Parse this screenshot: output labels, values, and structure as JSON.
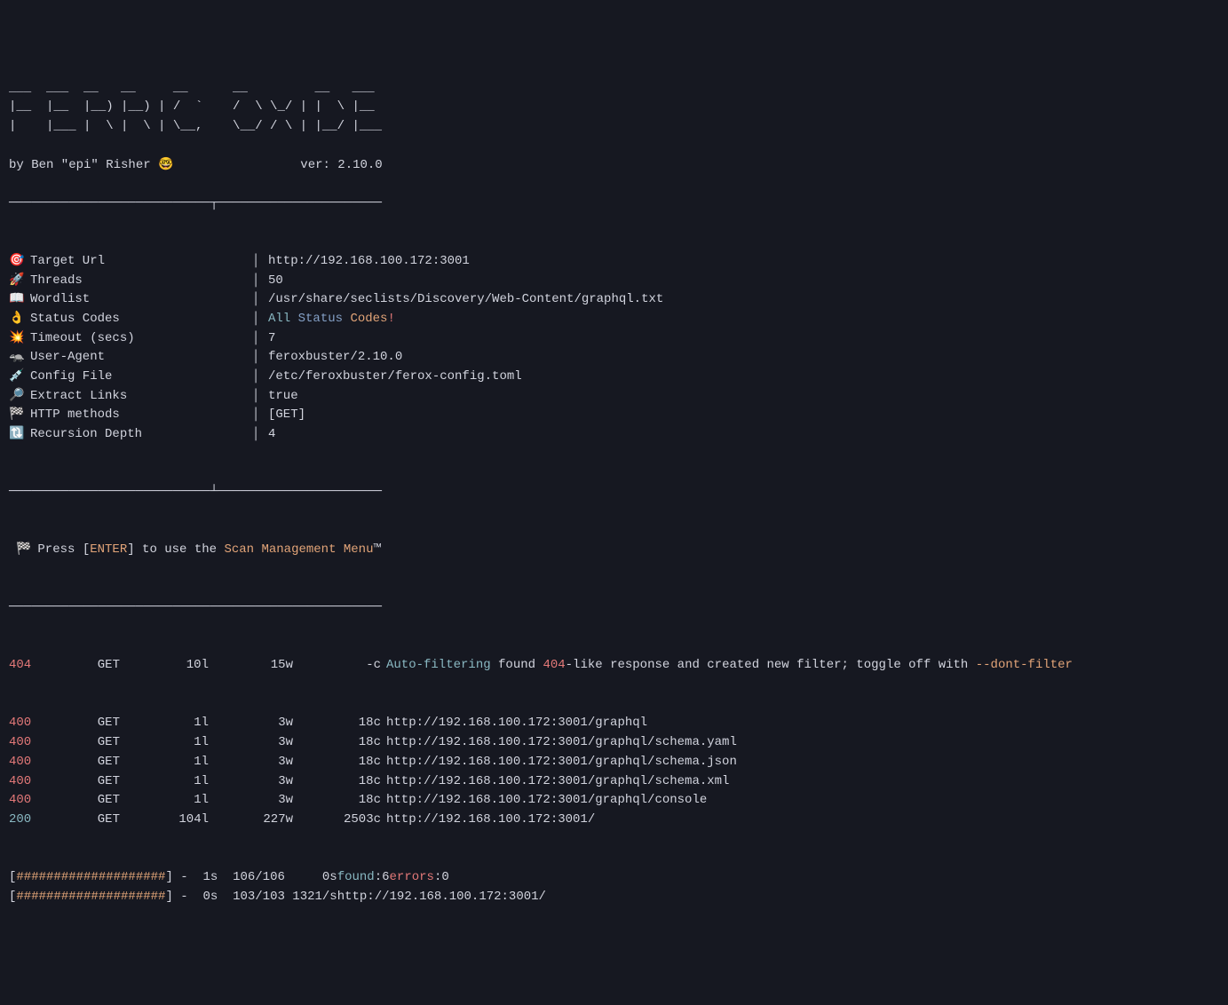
{
  "ascii_art": "___  ___  __   __     __      __         __   ___\n|__  |__  |__) |__) | /  `    /  \\ \\_/ | |  \\ |__\n|    |___ |  \\ |  \\ | \\__,    \\__/ / \\ | |__/ |___",
  "byline_left": "by Ben \"epi\" Risher 🤓",
  "byline_right": "ver: 2.10.0",
  "top_sep": "───────────────────────────┬──────────────────────",
  "mid_sep": "───────────────────────────┴──────────────────────",
  "bottom_sep": "──────────────────────────────────────────────────",
  "config": [
    {
      "icon": "🎯",
      "label": "Target Url",
      "value_plain": "http://192.168.100.172:3001"
    },
    {
      "icon": "🚀",
      "label": "Threads",
      "value_plain": "50"
    },
    {
      "icon": "📖",
      "label": "Wordlist",
      "value_plain": "/usr/share/seclists/Discovery/Web-Content/graphql.txt"
    },
    {
      "icon": "👌",
      "label": "Status Codes",
      "value_html": true,
      "p1": "All",
      "p2": "Status",
      "p3": "Codes",
      "p4": "!"
    },
    {
      "icon": "💥",
      "label": "Timeout (secs)",
      "value_plain": "7"
    },
    {
      "icon": "🦡",
      "label": "User-Agent",
      "value_plain": "feroxbuster/2.10.0"
    },
    {
      "icon": "💉",
      "label": "Config File",
      "value_plain": "/etc/feroxbuster/ferox-config.toml"
    },
    {
      "icon": "🔎",
      "label": "Extract Links",
      "value_plain": "true"
    },
    {
      "icon": "🏁",
      "label": "HTTP methods",
      "value_plain": "[GET]"
    },
    {
      "icon": "🔃",
      "label": "Recursion Depth",
      "value_plain": "4"
    }
  ],
  "press": {
    "icon": "🏁",
    "p1": "Press [",
    "enter": "ENTER",
    "p2": "] to use the ",
    "menu": "Scan Management Menu",
    "tm": "™"
  },
  "autofilter": {
    "status": "404",
    "method": "GET",
    "lines": "10l",
    "words": "15w",
    "chars": "-c",
    "t1": "Auto-filtering",
    "t2": " found ",
    "t3": "404",
    "t4": "-like response and created new filter; toggle off with ",
    "t5": "--dont-filter"
  },
  "results": [
    {
      "status": "400",
      "scls": "red",
      "method": "GET",
      "lines": "1l",
      "words": "3w",
      "chars": "18c",
      "url": "http://192.168.100.172:3001/graphql"
    },
    {
      "status": "400",
      "scls": "red",
      "method": "GET",
      "lines": "1l",
      "words": "3w",
      "chars": "18c",
      "url": "http://192.168.100.172:3001/graphql/schema.yaml"
    },
    {
      "status": "400",
      "scls": "red",
      "method": "GET",
      "lines": "1l",
      "words": "3w",
      "chars": "18c",
      "url": "http://192.168.100.172:3001/graphql/schema.json"
    },
    {
      "status": "400",
      "scls": "red",
      "method": "GET",
      "lines": "1l",
      "words": "3w",
      "chars": "18c",
      "url": "http://192.168.100.172:3001/graphql/schema.xml"
    },
    {
      "status": "400",
      "scls": "red",
      "method": "GET",
      "lines": "1l",
      "words": "3w",
      "chars": "18c",
      "url": "http://192.168.100.172:3001/graphql/console"
    },
    {
      "status": "200",
      "scls": "teal",
      "method": "GET",
      "lines": "104l",
      "words": "227w",
      "chars": "2503c",
      "url": "http://192.168.100.172:3001/"
    }
  ],
  "progress": [
    {
      "bar": "####################",
      "time": "1s",
      "count": "106/106",
      "rate": "0s",
      "found_label": "found",
      "found_val": ":6",
      "errors_label": "errors",
      "errors_val": ":0",
      "url": ""
    },
    {
      "bar": "####################",
      "time": "0s",
      "count": "103/103",
      "rate": "1321/s",
      "url": "http://192.168.100.172:3001/"
    }
  ]
}
